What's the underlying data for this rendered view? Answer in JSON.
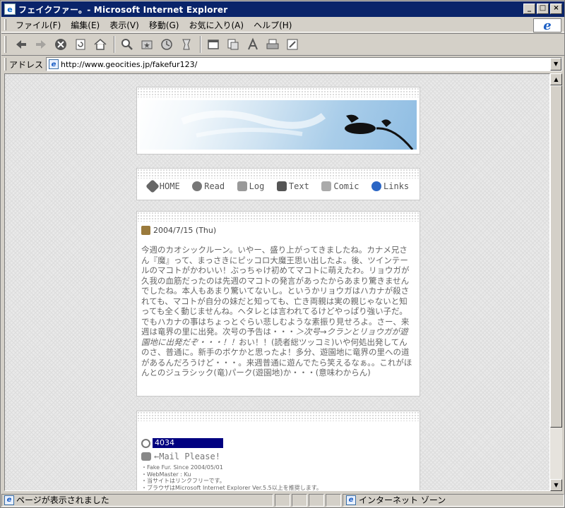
{
  "window": {
    "title": "フェイクファー。- Microsoft Internet Explorer",
    "buttons": {
      "min": "_",
      "max": "□",
      "close": "×"
    }
  },
  "menu": {
    "items": [
      "ファイル(F)",
      "編集(E)",
      "表示(V)",
      "移動(G)",
      "お気に入り(A)",
      "ヘルプ(H)"
    ],
    "logo": "e"
  },
  "toolbar": {
    "icons": [
      "back-icon",
      "forward-icon",
      "stop-icon",
      "refresh-icon",
      "home-icon",
      "search-icon",
      "favorites-icon",
      "history-icon",
      "channels-icon",
      "fullscreen-icon",
      "mail-icon",
      "font-icon",
      "print-icon",
      "edit-icon"
    ]
  },
  "address": {
    "label": "アドレス",
    "url": "http://www.geocities.jp/fakefur123/"
  },
  "nav": {
    "items": [
      "HOME",
      "Read",
      "Log",
      "Text",
      "Comic",
      "Links"
    ]
  },
  "post": {
    "date": "2004/7/15 (Thu)",
    "body_1": "今週のカオシックルーン。いやー、盛り上がってきましたね。カナメ兄さん『魔』って、まっさきにピッコロ大魔王思い出したよ。後、ツインテールのマコトがかわいい！ぶっちゃけ初めてマコトに萌えたわ。リョウガが久我の血筋だったのは先週のマコトの発言があったからあまり驚きませんでしたね。本人もあまり驚いてないし。というかリョウガはハカナが殺されても、マコトが自分の妹だと知っても、亡き両親は実の親じゃないと知っても全く動じませんね。ヘタレとは言われてるけどやっぱり強い子だ。でもハカナの事はちょっとぐらい悲しむような素振り見せろよ。さー、来週は竜界の里に出発。次号の予告は・・・",
    "highlight": "＞次号→クランとリョウガが遊園地に出発だぞ・・・！！",
    "body_2": "おい！！(読者総ツッコミ)いや何処出発してんのさ、普通に。新手のボケかと思ったよ！多分、遊園地に竜界の里への道があるんだろうけど・・・。来週普通に遊んでたら笑えるなぁ。。これがほんとのジュラシック(竜)パーク(遊園地)か・・・(意味わからん)"
  },
  "sidebar": {
    "counter": "4034",
    "mail": "←Mail Please!",
    "footer_1": "・Fake Fur. Since 2004/05/01",
    "footer_2": "・WebMaster : Ku",
    "footer_3": "・当サイトはリンクフリーです。",
    "footer_4": "・ブラウザはMicrosoft Internet Explorer Ver.5.5以上を推奨します。"
  },
  "status": {
    "text": "ページが表示されました",
    "zone": "インターネット ゾーン"
  }
}
